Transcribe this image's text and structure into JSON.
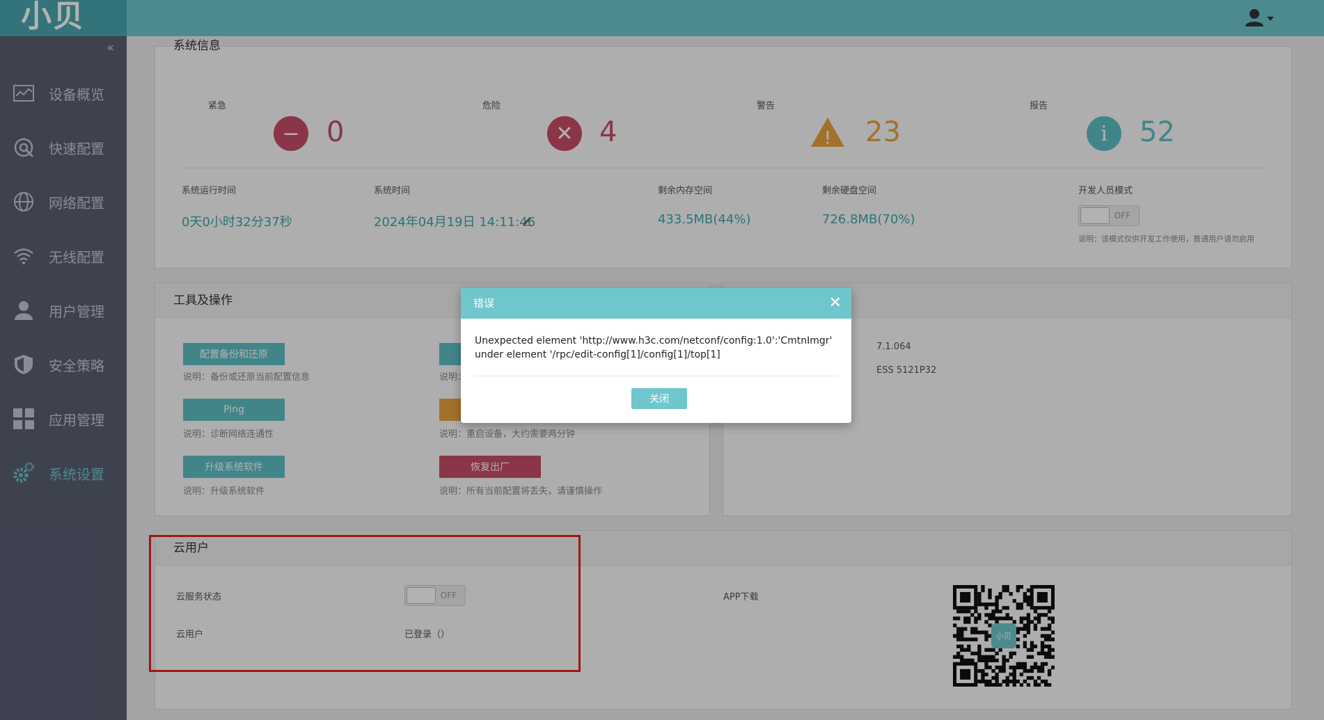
{
  "app": {
    "logo": "小贝"
  },
  "sidebar": {
    "collapse": "«",
    "items": [
      {
        "label": "设备概览",
        "icon": "chart-icon"
      },
      {
        "label": "快速配置",
        "icon": "quick-config-icon"
      },
      {
        "label": "网络配置",
        "icon": "globe-icon"
      },
      {
        "label": "无线配置",
        "icon": "wifi-icon"
      },
      {
        "label": "用户管理",
        "icon": "user-icon"
      },
      {
        "label": "安全策略",
        "icon": "shield-icon"
      },
      {
        "label": "应用管理",
        "icon": "apps-grid-icon"
      },
      {
        "label": "系统设置",
        "icon": "gears-icon",
        "active": true
      }
    ]
  },
  "sysinfo": {
    "header": "系统信息",
    "alerts": [
      {
        "label": "紧急",
        "count": "0",
        "symbol": "−",
        "color": "#c64d67"
      },
      {
        "label": "危险",
        "count": "4",
        "symbol": "✕",
        "color": "#c64d67"
      },
      {
        "label": "警告",
        "count": "23",
        "symbol": "!",
        "color": "#e8a23d"
      },
      {
        "label": "报告",
        "count": "52",
        "symbol": "i",
        "color": "#5fbfc4"
      }
    ],
    "stats": [
      {
        "label": "系统运行时间",
        "value": "0天0小时32分37秒"
      },
      {
        "label": "系统时间",
        "value": "2024年04月19日 14:11:46"
      },
      {
        "label": "剩余内存空间",
        "value": "433.5MB(44%)"
      },
      {
        "label": "剩余硬盘空间",
        "value": "726.8MB(70%)"
      }
    ],
    "dev_mode": {
      "label": "开发人员模式",
      "toggle": "OFF",
      "note": "说明：该模式仅供开发工作使用，普通用户请勿启用"
    }
  },
  "tools": {
    "header": "工具及操作",
    "buttons": [
      {
        "label": "配置备份和还原",
        "note": "说明：备份或还原当前配置信息"
      },
      {
        "label": "Ping",
        "note": "说明：诊断网络连通性"
      },
      {
        "label": "升级系统软件",
        "note": "说明：升级系统软件"
      },
      {
        "label": "",
        "note": "说明："
      },
      {
        "label": "",
        "note": "说明：重启设备，大约需要两分钟"
      },
      {
        "label": "恢复出厂",
        "note": "说明：所有当前配置将丢失，请谨慎操作"
      }
    ]
  },
  "version": {
    "line1": "7.1.064",
    "line2": "ESS 5121P32"
  },
  "cloud": {
    "header": "云用户",
    "status_label": "云服务状态",
    "status_toggle": "OFF",
    "user_label": "云用户",
    "user_value": "已登录（）",
    "app_label": "APP下载",
    "qr_center": "小贝"
  },
  "modal": {
    "title": "错误",
    "close": "✕",
    "message": "Unexpected element 'http://www.h3c.com/netconf/config:1.0':'CmtnImgr' under element '/rpc/edit-config[1]/config[1]/top[1]",
    "button": "关闭"
  },
  "colors": {
    "teal": "#6fc6cc",
    "sidebar": "#5a5f72",
    "red": "#c64d67",
    "orange": "#e8a23d"
  }
}
